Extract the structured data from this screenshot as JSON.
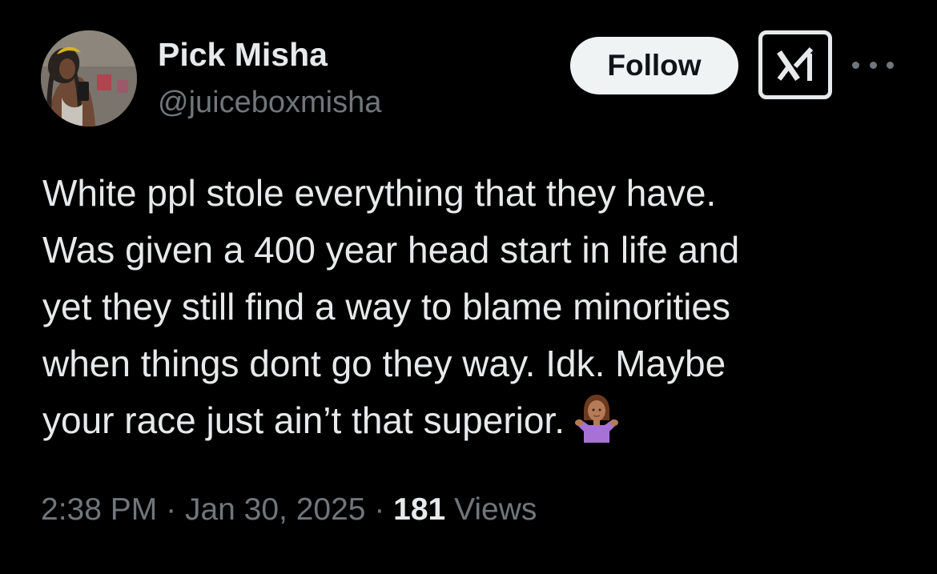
{
  "author": {
    "display_name": "Pick Misha",
    "handle": "@juiceboxmisha"
  },
  "actions": {
    "follow_label": "Follow",
    "grok_icon": "grok-icon",
    "more_icon": "more-icon"
  },
  "tweet": {
    "lines": [
      "White ppl stole everything that they have.",
      "Was given a 400 year head start in life and",
      "yet they still find a way to blame minorities",
      "when things dont go they way. Idk. Maybe",
      "your race just ain’t that superior."
    ],
    "emoji": "person-shrugging-emoji"
  },
  "meta": {
    "time": "2:38 PM",
    "separator": "·",
    "date": "Jan 30, 2025",
    "views_count": "181",
    "views_label": "Views"
  },
  "colors": {
    "background": "#000000",
    "primary_text": "#e7e9ea",
    "secondary_text": "#71767b",
    "follow_button_bg": "#eff3f4"
  }
}
